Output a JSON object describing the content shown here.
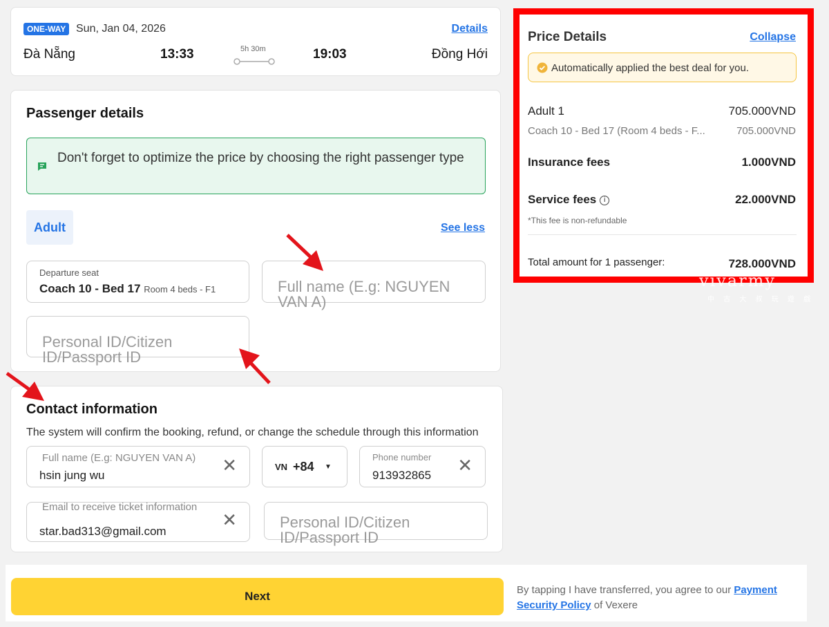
{
  "trip": {
    "badge": "ONE-WAY",
    "date": "Sun, Jan 04, 2026",
    "details_link": "Details",
    "from": "Đà Nẵng",
    "departure_time": "13:33",
    "duration": "5h 30m",
    "arrival_time": "19:03",
    "to": "Đồng Hới"
  },
  "passenger": {
    "title": "Passenger details",
    "tip": "Don't forget to optimize the price by choosing the right passenger type",
    "tab_adult": "Adult",
    "see_less": "See less",
    "seat_label": "Departure seat",
    "seat_value": "Coach 10 - Bed 17",
    "seat_sub": "Room 4 beds - F1",
    "name_placeholder": "Full name (E.g: NGUYEN VAN A)",
    "id_placeholder": "Personal ID/Citizen ID/Passport ID"
  },
  "contact": {
    "title": "Contact information",
    "description": "The system will confirm the booking, refund, or change the schedule through this information",
    "name_label": "Full name (E.g: NGUYEN VAN A)",
    "name_value": "hsin jung wu",
    "country": "VN",
    "country_code": "+84",
    "phone_label": "Phone number",
    "phone_value": "913932865",
    "email_label": "Email to receive ticket information",
    "email_value": "star.bad313@gmail.com",
    "id_placeholder": "Personal ID/Citizen ID/Passport ID"
  },
  "price": {
    "title": "Price Details",
    "collapse": "Collapse",
    "deal_text": "Automatically applied the best deal for you.",
    "adult_label": "Adult 1",
    "adult_price": "705.000VND",
    "seat_detail": "Coach 10 - Bed 17 (Room 4 beds - F...",
    "seat_price": "705.000VND",
    "insurance_label": "Insurance fees",
    "insurance_price": "1.000VND",
    "service_label": "Service fees",
    "service_price": "22.000VND",
    "service_note": "*This fee is non-refundable",
    "total_label": "Total amount for 1 passenger:",
    "total_price": "728.000VND"
  },
  "watermark": {
    "main": "vivarmy",
    "sub": "中 古 大 叔 玩 遊 戲"
  },
  "footer": {
    "next": "Next",
    "terms_prefix": "By tapping I have transferred, you agree to our ",
    "terms_link": "Payment Security Policy",
    "terms_suffix": " of Vexere"
  },
  "colors": {
    "accent": "#2474e5",
    "next_button": "#ffd333",
    "highlight_frame": "#ff0000",
    "annotation_arrow": "#e3141b",
    "tip_bg": "#e8f7ee",
    "tip_border": "#27a35a"
  }
}
